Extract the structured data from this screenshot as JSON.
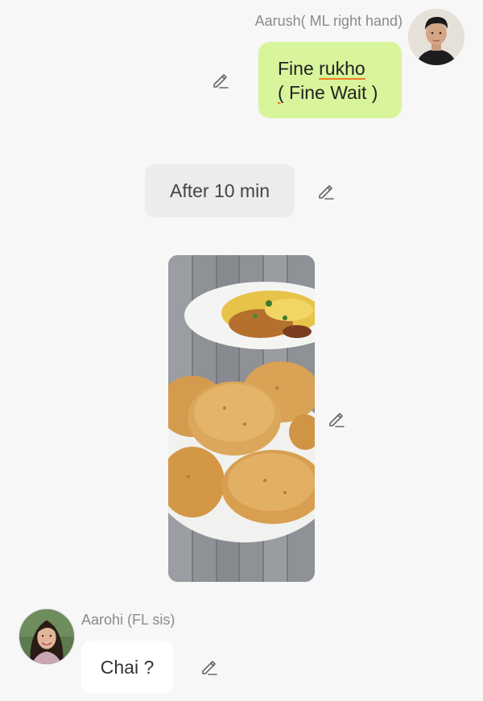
{
  "messages": [
    {
      "sender": "Aarush( ML right hand)",
      "lines": [
        "Fine ",
        "rukho",
        "(",
        " Fine Wait )"
      ]
    },
    {
      "text": "After 10 min"
    },
    {
      "type": "image",
      "alt": "food-photo"
    },
    {
      "sender": "Aarohi (FL sis)",
      "text": "Chai ?"
    }
  ],
  "colors": {
    "background": "#f7f7f7",
    "outgoing_bubble": "#d8f59c",
    "neutral_bubble": "#ececec",
    "incoming_bubble": "#ffffff",
    "spellcheck_underline": "#f07a1f",
    "sender_label": "#8a8a8a"
  },
  "icons": {
    "edit": "pencil-icon"
  }
}
